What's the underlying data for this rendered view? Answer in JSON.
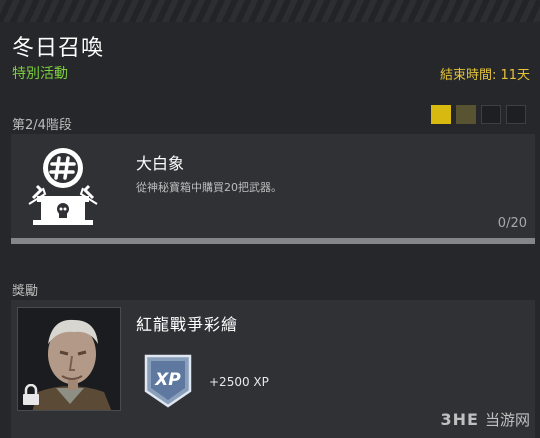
{
  "event": {
    "title": "冬日召喚",
    "subtitle": "特別活動",
    "time_remaining": "結束時間: 11天"
  },
  "stage": {
    "label": "第2/4階段",
    "pips": [
      "full",
      "partial",
      "empty",
      "empty"
    ]
  },
  "challenge": {
    "icon": "supply-drop-hashtag-icon",
    "name": "大白象",
    "description": "從神秘寶箱中購買20把武器。",
    "progress_text": "0/20",
    "progress_value": 0,
    "progress_max": 20
  },
  "reward": {
    "section_label": "獎勵",
    "name": "紅龍戰爭彩繪",
    "locked": true,
    "xp_badge_text": "XP",
    "xp_amount": "+2500 XP"
  },
  "watermark": {
    "logo": "3HE",
    "text": "当游网"
  },
  "colors": {
    "accent_yellow": "#e3c43a",
    "accent_green": "#7ccf3f",
    "pip_full": "#d8b90f",
    "pip_partial": "#585432",
    "panel": "#303135",
    "background": "#26272a"
  }
}
